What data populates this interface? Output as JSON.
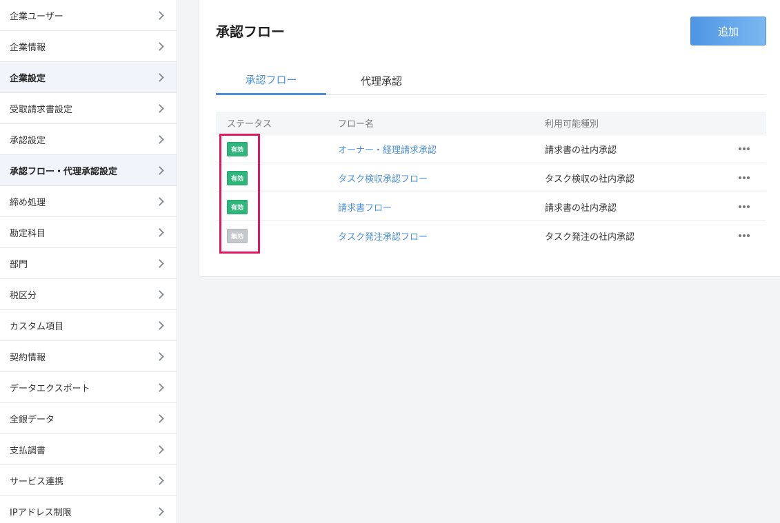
{
  "sidebar": {
    "items": [
      {
        "label": "企業ユーザー",
        "active": false
      },
      {
        "label": "企業情報",
        "active": false
      },
      {
        "label": "企業設定",
        "active": true
      },
      {
        "label": "受取請求書設定",
        "active": false
      },
      {
        "label": "承認設定",
        "active": false
      },
      {
        "label": "承認フロー・代理承認設定",
        "active": true
      },
      {
        "label": "締め処理",
        "active": false
      },
      {
        "label": "勘定科目",
        "active": false
      },
      {
        "label": "部門",
        "active": false
      },
      {
        "label": "税区分",
        "active": false
      },
      {
        "label": "カスタム項目",
        "active": false
      },
      {
        "label": "契約情報",
        "active": false
      },
      {
        "label": "データエクスポート",
        "active": false
      },
      {
        "label": "全銀データ",
        "active": false
      },
      {
        "label": "支払調書",
        "active": false
      },
      {
        "label": "サービス連携",
        "active": false
      },
      {
        "label": "IPアドレス制限",
        "active": false
      }
    ]
  },
  "main": {
    "title": "承認フロー",
    "add_label": "追加",
    "tabs": [
      {
        "label": "承認フロー",
        "active": true
      },
      {
        "label": "代理承認",
        "active": false
      }
    ],
    "table": {
      "headers": {
        "status": "ステータス",
        "name": "フロー名",
        "type": "利用可能種別"
      },
      "rows": [
        {
          "status": "有効",
          "enabled": true,
          "name": "オーナー・経理請求承認",
          "type": "請求書の社内承認"
        },
        {
          "status": "有効",
          "enabled": true,
          "name": "タスク検収承認フロー",
          "type": "タスク検収の社内承認"
        },
        {
          "status": "有効",
          "enabled": true,
          "name": "請求書フロー",
          "type": "請求書の社内承認"
        },
        {
          "status": "無効",
          "enabled": false,
          "name": "タスク発注承認フロー",
          "type": "タスク発注の社内承認"
        }
      ]
    }
  },
  "colors": {
    "accent": "#4a8fd8",
    "enabled_badge": "#2fb67c",
    "disabled_badge": "#c4c7cb",
    "highlight": "#e0185f"
  },
  "icons": {
    "sidebar_item": "chevron-right-icon",
    "row_menu": "more-horizontal-icon"
  }
}
